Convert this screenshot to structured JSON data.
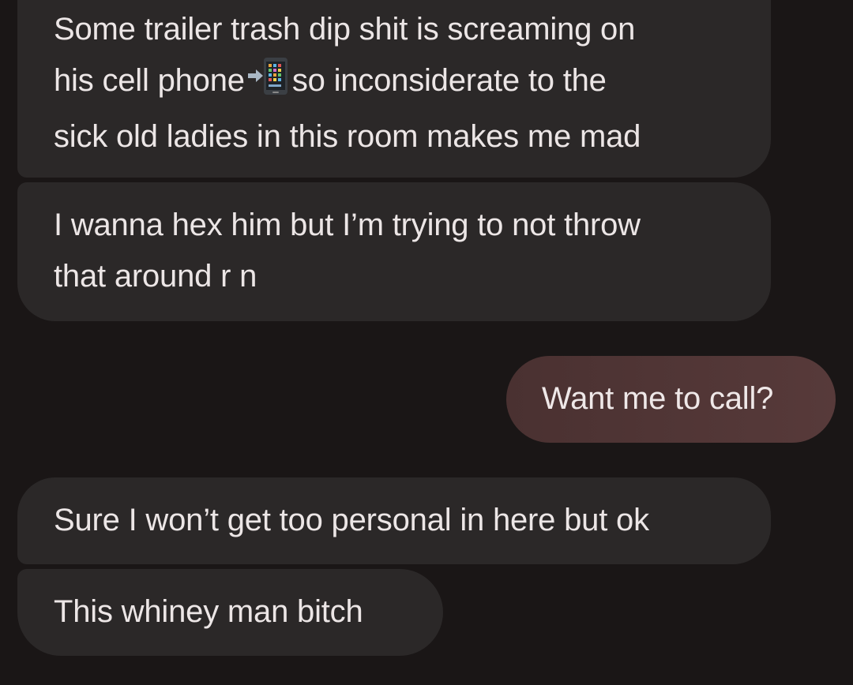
{
  "conversation": {
    "messages": [
      {
        "sender": "them",
        "lines": [
          "Some trailer trash dip shit is screaming on",
          "his cell phone",
          "so inconsiderate to the",
          "sick old ladies in this room makes me mad"
        ],
        "emoji": "phone-with-arrow-emoji"
      },
      {
        "sender": "them",
        "lines": [
          "I wanna hex him but I’m trying to not throw",
          "that around r n"
        ]
      },
      {
        "sender": "me",
        "lines": [
          "Want me to call?"
        ]
      },
      {
        "sender": "them",
        "lines": [
          "Sure I won’t get too personal in here but ok"
        ]
      },
      {
        "sender": "them",
        "lines": [
          "This whiney man bitch"
        ]
      }
    ]
  },
  "colors": {
    "background": "#1a1616",
    "incoming_bubble": "#2b2828",
    "outgoing_bubble": "#533737",
    "text": "#ece6e6"
  }
}
